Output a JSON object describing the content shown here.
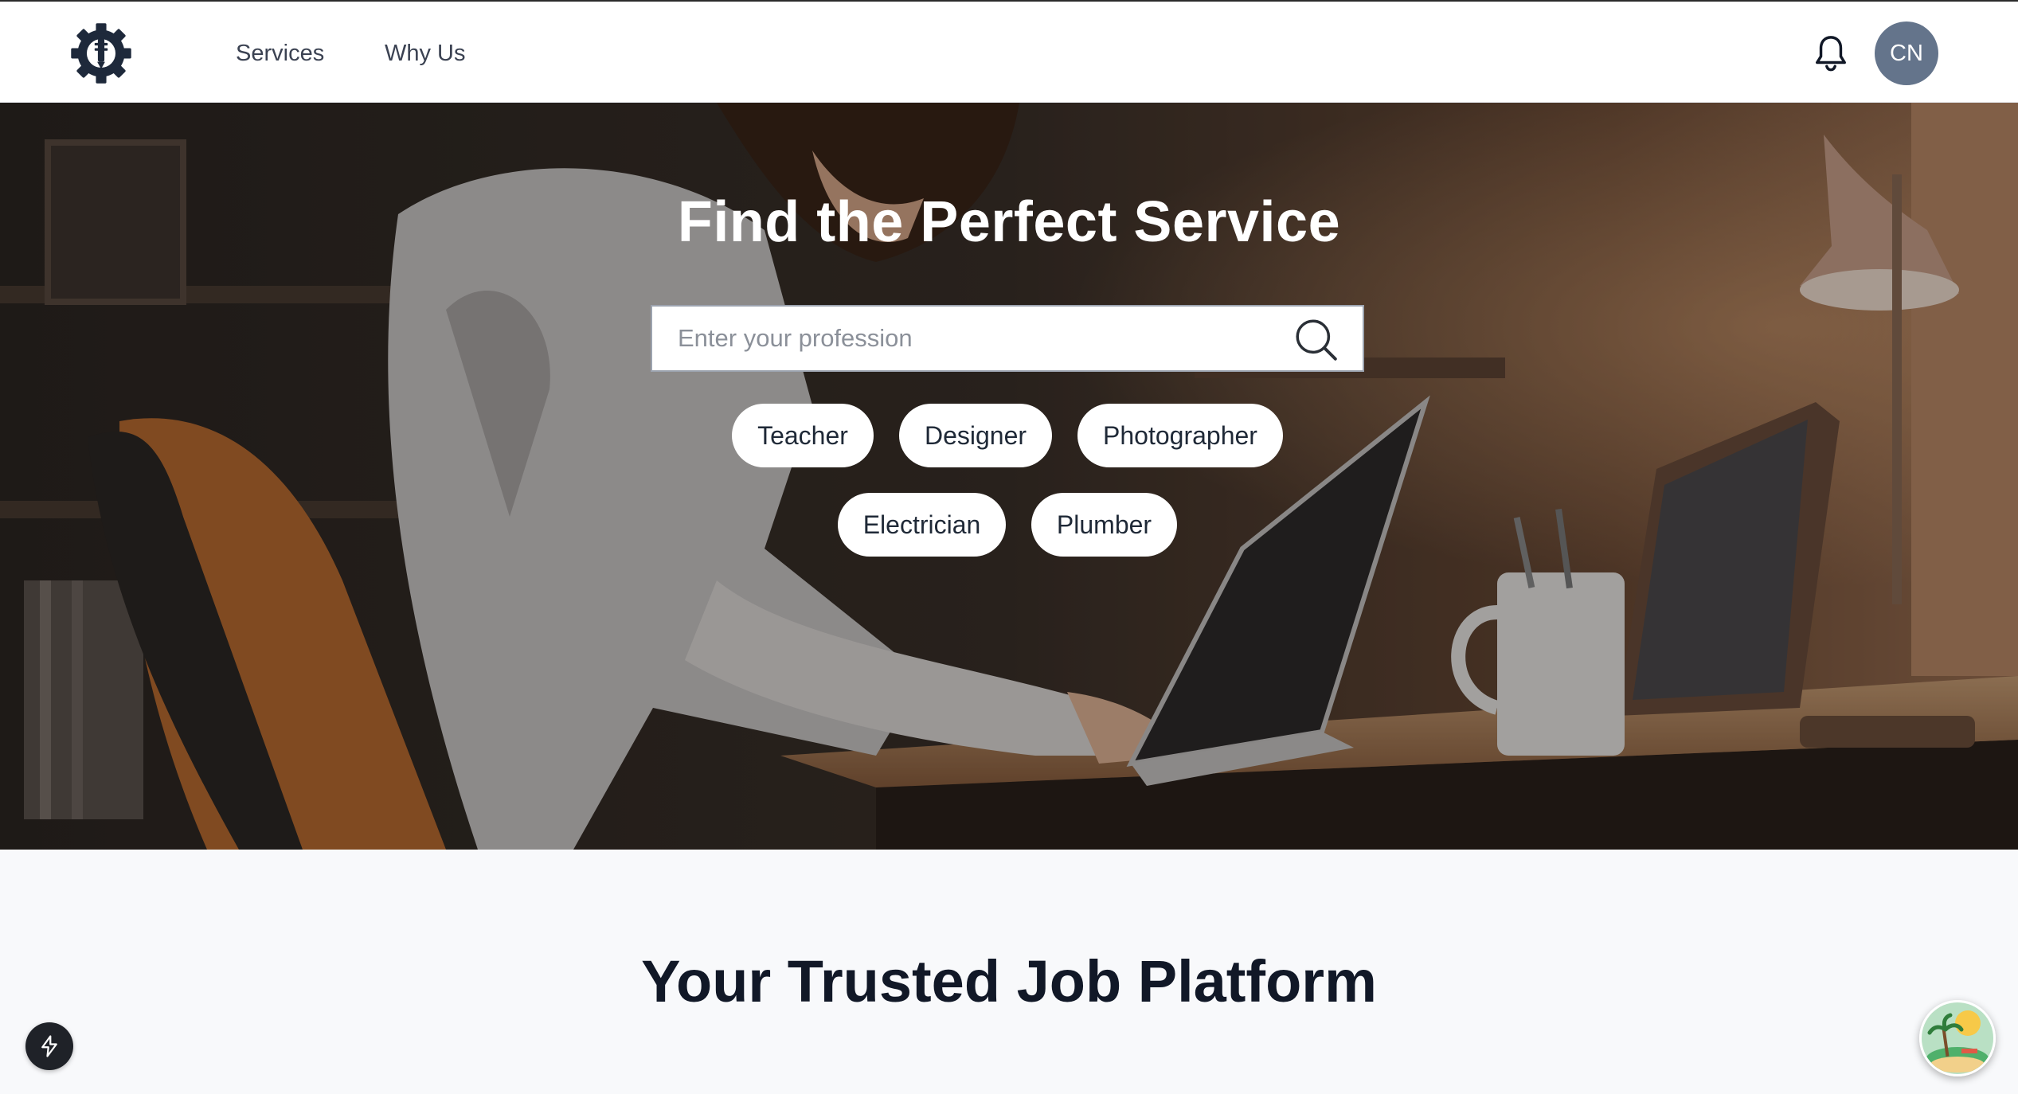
{
  "header": {
    "nav": [
      {
        "label": "Services"
      },
      {
        "label": "Why Us"
      }
    ],
    "avatar_initials": "CN",
    "icons": {
      "logo": "gear-logo-icon",
      "notifications": "bell-icon"
    }
  },
  "hero": {
    "title": "Find the Perfect Service",
    "search": {
      "placeholder": "Enter your profession",
      "value": "",
      "icon": "search-icon"
    },
    "suggestions": [
      "Teacher",
      "Designer",
      "Photographer",
      "Electrician",
      "Plumber"
    ]
  },
  "section": {
    "title": "Your Trusted Job Platform"
  },
  "floating": {
    "left_icon": "lightning-icon",
    "right_icon": "island-avatar-icon"
  },
  "colors": {
    "header_bg": "#ffffff",
    "avatar_bg": "#64748b",
    "logo": "#1e293b",
    "page_bg": "#f8f9fb",
    "title_dark": "#111827"
  }
}
